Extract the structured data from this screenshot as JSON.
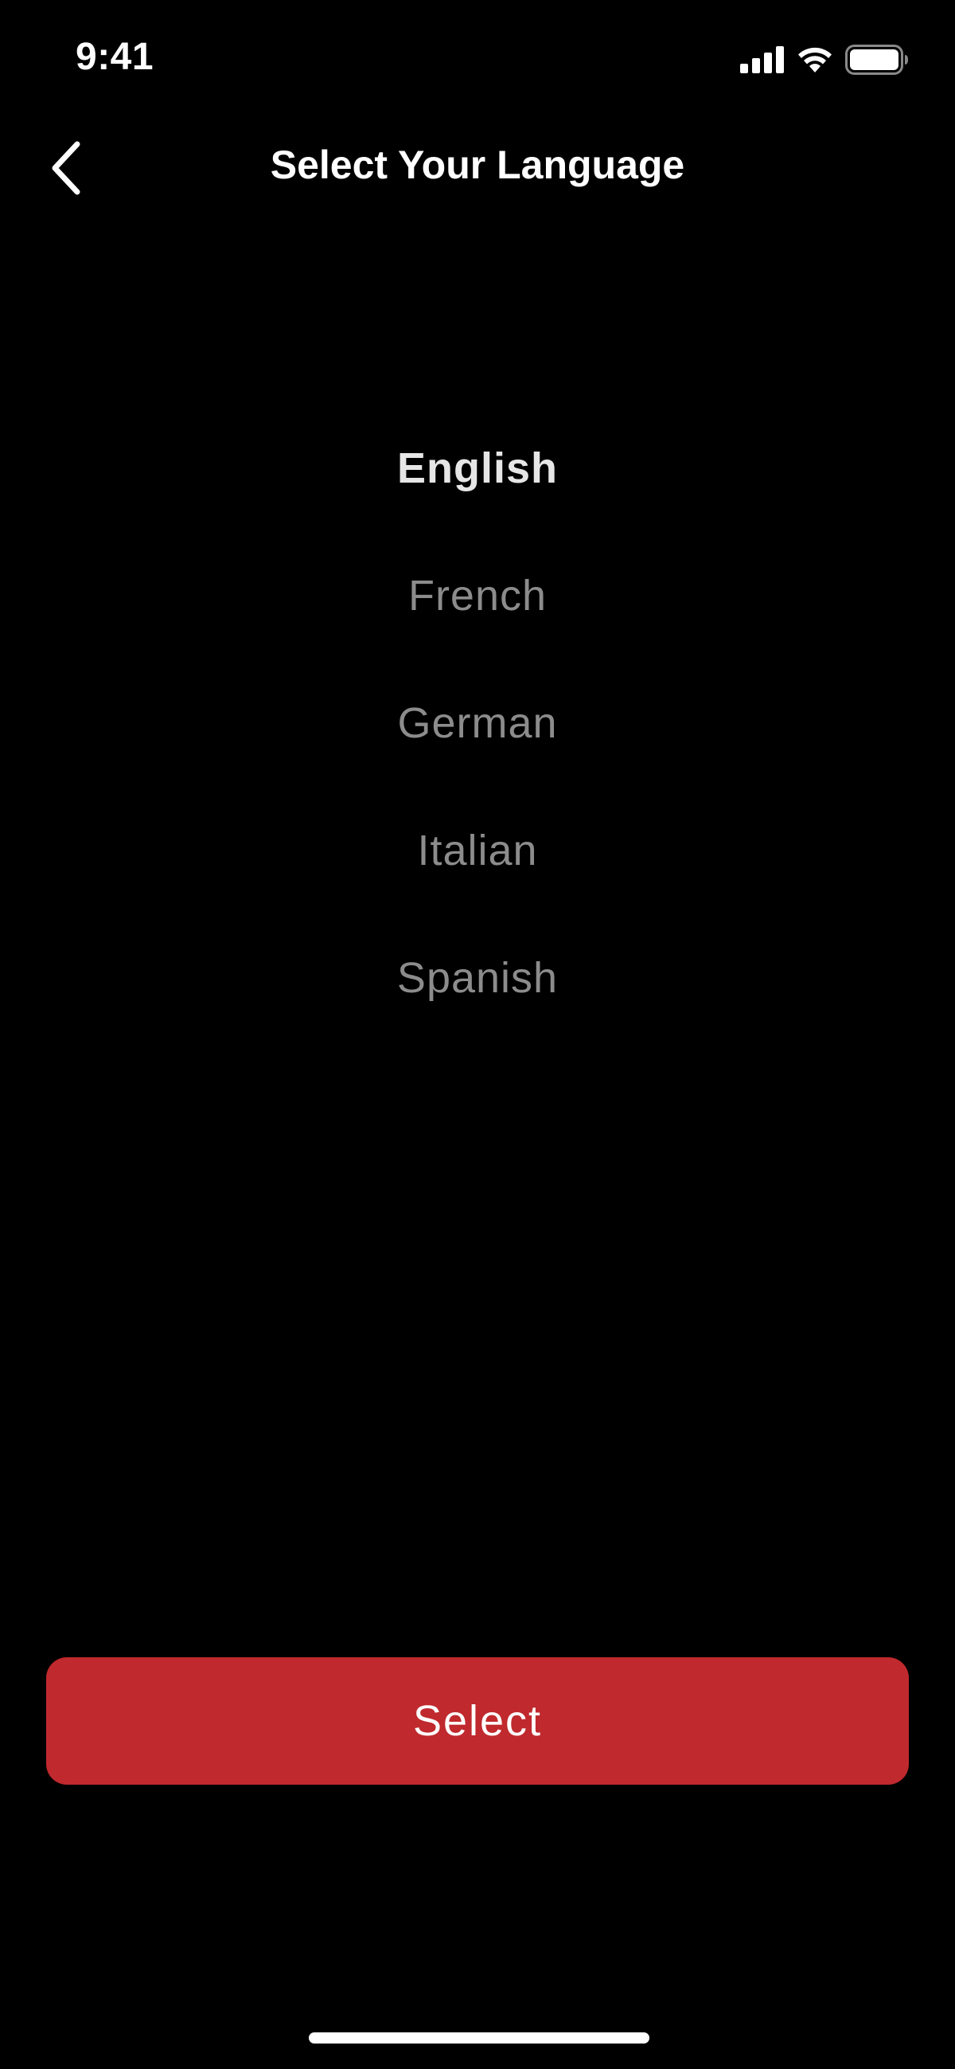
{
  "status_bar": {
    "time": "9:41",
    "icons": [
      "cellular-signal-icon",
      "wifi-icon",
      "battery-icon"
    ]
  },
  "header": {
    "title": "Select Your Language",
    "back_icon": "chevron-left-icon"
  },
  "languages": {
    "selected": "English",
    "items": [
      {
        "label": "English",
        "selected": true
      },
      {
        "label": "French",
        "selected": false
      },
      {
        "label": "German",
        "selected": false
      },
      {
        "label": "Italian",
        "selected": false
      },
      {
        "label": "Spanish",
        "selected": false
      }
    ]
  },
  "action": {
    "select_label": "Select"
  },
  "colors": {
    "background": "#000000",
    "accent": "#c0292d",
    "selected_text": "#e6e6e6",
    "unselected_text": "#8c8c8c"
  }
}
